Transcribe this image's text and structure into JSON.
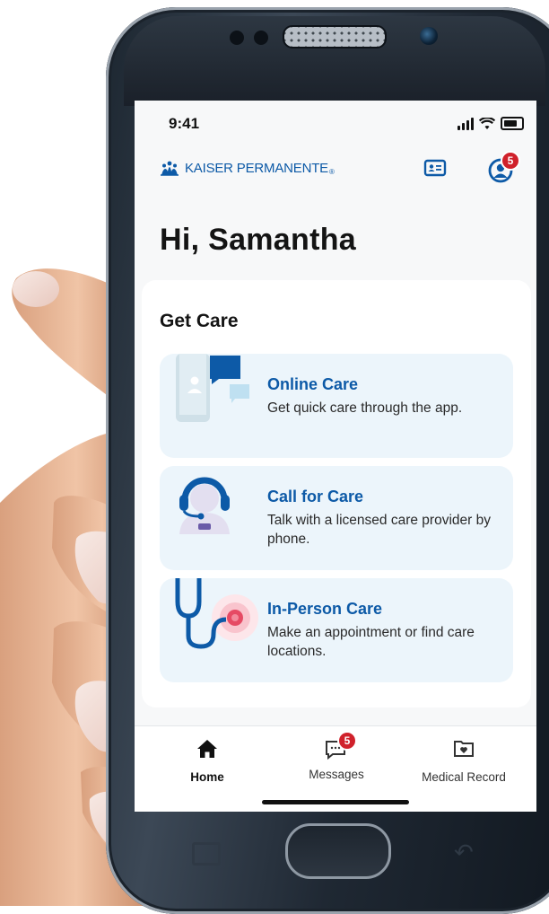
{
  "status_bar": {
    "time": "9:41"
  },
  "header": {
    "brand": "KAISER PERMANENTE",
    "brand_mark": "®",
    "profile_badge": "5"
  },
  "greeting": "Hi, Samantha",
  "get_care": {
    "title": "Get Care",
    "items": [
      {
        "title": "Online Care",
        "description": "Get quick care through the app."
      },
      {
        "title": "Call for Care",
        "description": "Talk with a licensed care provider by phone."
      },
      {
        "title": "In-Person Care",
        "description": "Make an appointment or find care locations."
      }
    ]
  },
  "bottom_nav": {
    "items": [
      {
        "label": "Home",
        "icon": "home-icon",
        "active": true
      },
      {
        "label": "Messages",
        "icon": "messages-icon",
        "badge": "5"
      },
      {
        "label": "Medical Record",
        "icon": "medical-record-icon"
      }
    ]
  },
  "colors": {
    "brand_blue": "#0d5aa7",
    "card_bg": "#ecf5fb",
    "badge_red": "#d0212b",
    "screen_bg": "#f7f8f9"
  }
}
